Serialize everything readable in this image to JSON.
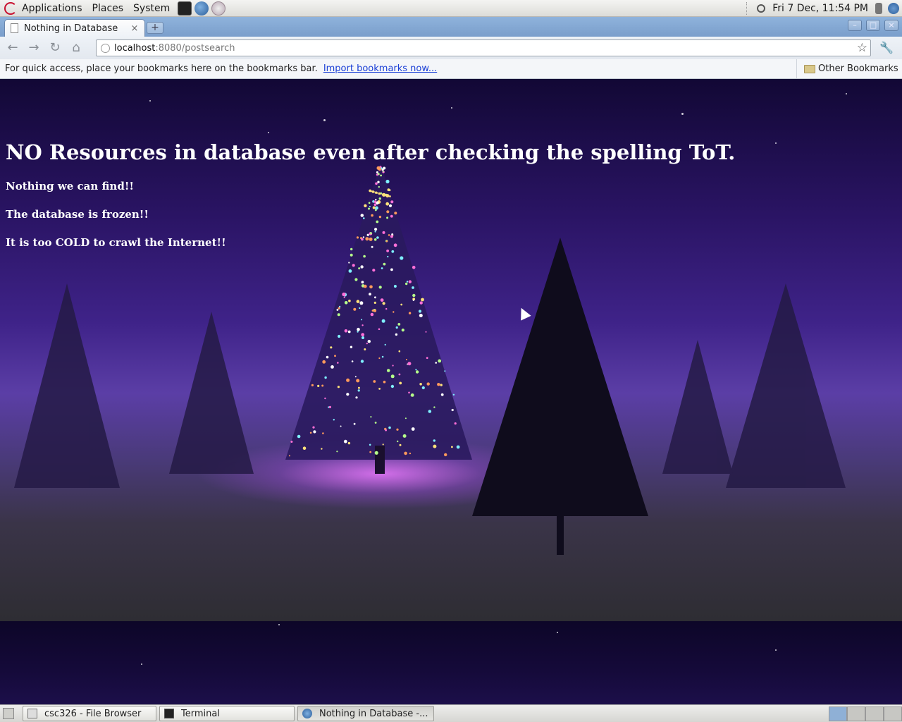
{
  "top_panel": {
    "menus": [
      "Applications",
      "Places",
      "System"
    ],
    "clock": "Fri  7 Dec, 11:54 PM"
  },
  "browser": {
    "tab_title": "Nothing in Database",
    "tab_close": "×",
    "new_tab": "+",
    "url_host": "localhost",
    "url_rest": ":8080/postsearch",
    "bookmarks_text": "For quick access, place your bookmarks here on the bookmarks bar.",
    "bookmarks_link": "Import bookmarks now...",
    "other_bookmarks": "Other Bookmarks"
  },
  "page": {
    "heading": "NO Resources in database even after checking the spelling ToT.",
    "messages": [
      "Nothing we can find!!",
      "The database is frozen!!",
      "It is too COLD to crawl the Internet!!"
    ]
  },
  "taskbar": {
    "items": [
      "csc326 - File Browser",
      "Terminal",
      "Nothing in Database -..."
    ]
  },
  "colors": {
    "sky_top": "#120835",
    "glow": "#eb78ff",
    "link": "#1a3fd6"
  }
}
